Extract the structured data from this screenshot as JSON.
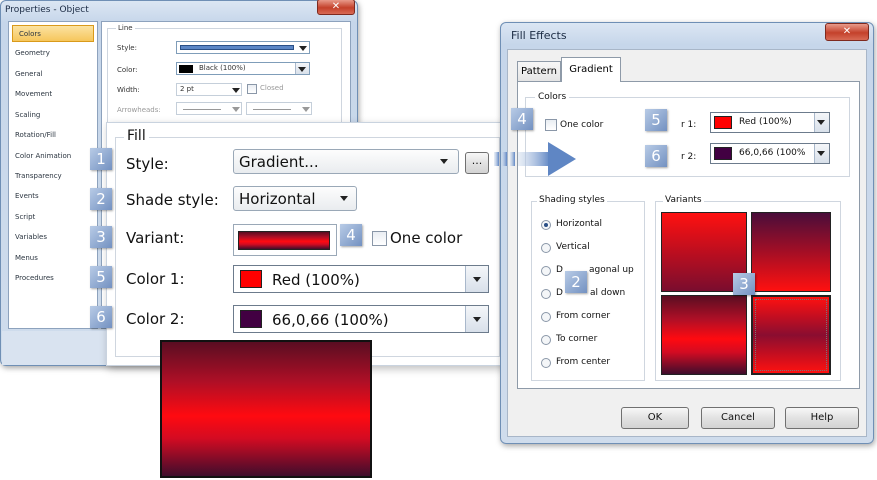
{
  "properties_window": {
    "title": "Properties - Object",
    "sidebar": [
      "Colors",
      "Geometry",
      "General",
      "Movement",
      "Scaling",
      "Rotation/Fill",
      "Color Animation",
      "Transparency",
      "Events",
      "Script",
      "Variables",
      "Menus",
      "Procedures"
    ],
    "line": {
      "group_label": "Line",
      "style_label": "Style:",
      "color_label": "Color:",
      "color_value": "Black (100%)",
      "width_label": "Width:",
      "width_value": "2 pt",
      "closed_label": "Closed",
      "arrowheads_label": "Arrowheads:"
    },
    "fill": {
      "group_label": "Fill",
      "style_label": "Style:",
      "style_value": "Gradient...",
      "more_button": "...",
      "shade_label": "Shade style:",
      "shade_value": "Horizontal",
      "variant_label": "Variant:",
      "one_color_label": "One color",
      "color1_label": "Color 1:",
      "color1_value": "Red (100%)",
      "color2_label": "Color 2:",
      "color2_value": "66,0,66 (100%)"
    }
  },
  "fill_effects": {
    "title": "Fill Effects",
    "tabs": [
      "Pattern",
      "Gradient"
    ],
    "active_tab": "Gradient",
    "colors_group": "Colors",
    "one_color_label": "One color",
    "color1_label_partial": "r 1:",
    "color1_value": "Red (100%)",
    "color2_label_partial": "r 2:",
    "color2_value": "66,0,66 (100%",
    "shading_group": "Shading styles",
    "shading_options": [
      "Horizontal",
      "Vertical",
      "D",
      "agonal up",
      "D",
      "al down",
      "From corner",
      "To corner",
      "From center"
    ],
    "variants_group": "Variants",
    "buttons": {
      "ok": "OK",
      "cancel": "Cancel",
      "help": "Help"
    }
  },
  "callouts": [
    "1",
    "2",
    "3",
    "4",
    "5",
    "6"
  ],
  "colors": {
    "color1": "#ff0000",
    "color2": "#420042",
    "accent": "#7391c1"
  },
  "icons": {
    "close": "close-icon",
    "dropdown": "chevron-down-icon",
    "arrow": "arrow-right-icon"
  }
}
